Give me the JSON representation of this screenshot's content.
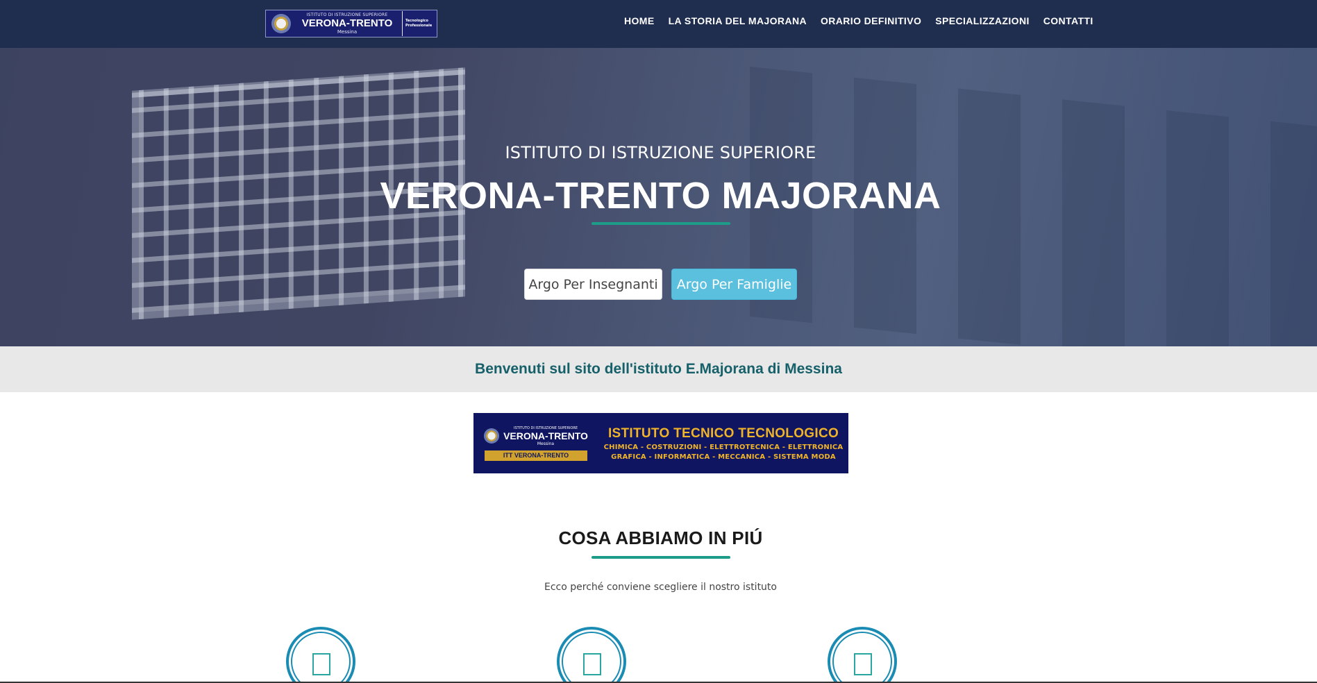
{
  "logo": {
    "top": "ISTITUTO DI ISTRUZIONE SUPERIORE",
    "title": "VERONA-TRENTO",
    "city": "Messina",
    "side": [
      "Tecnologico",
      "Professionale"
    ]
  },
  "nav": {
    "items": [
      {
        "label": "HOME"
      },
      {
        "label": "LA STORIA DEL MAJORANA"
      },
      {
        "label": "ORARIO DEFINITIVO"
      },
      {
        "label": "SPECIALIZZAZIONI"
      },
      {
        "label": "CONTATTI"
      }
    ]
  },
  "hero": {
    "subtitle": "ISTITUTO DI ISTRUZIONE SUPERIORE",
    "title": "VERONA-TRENTO MAJORANA",
    "buttons": {
      "teachers": "Argo Per Insegnanti",
      "families": "Argo Per Famiglie"
    }
  },
  "welcome": {
    "text": "Benvenuti sul sito dell'istituto E.Majorana di Messina",
    "icon_left": "",
    "icon_right": ""
  },
  "banner": {
    "logo_top": "ISTITUTO DI ISTRUZIONE SUPERIORE",
    "logo_title": "VERONA-TRENTO",
    "logo_city": "Messina",
    "tag": "ITT VERONA-TRENTO",
    "title": "ISTITUTO TECNICO TECNOLOGICO",
    "line1": "CHIMICA - COSTRUZIONI - ELETTROTECNICA - ELETTRONICA",
    "line2": "GRAFICA - INFORMATICA - MECCANICA - SISTEMA MODA"
  },
  "features": {
    "title": "COSA ABBIAMO IN PIÚ",
    "subtitle": "Ecco perché conviene scegliere il nostro istituto"
  },
  "colors": {
    "navbar": "#1f2d4f",
    "accent": "#1e9c8a",
    "welcome_text": "#16606a",
    "families_button": "#5bc0de",
    "circle": "#1a8cb4"
  }
}
